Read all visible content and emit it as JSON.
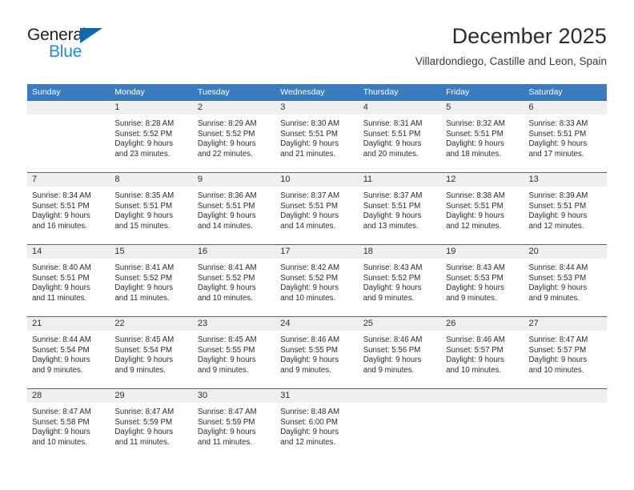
{
  "brand": {
    "name_part1": "General",
    "name_part2": "Blue",
    "logo_icon": "triangle-icon",
    "color_dark": "#231f20",
    "color_blue": "#1a8fdd",
    "color_triangle": "#0b68b2"
  },
  "header": {
    "title": "December 2025",
    "subtitle": "Villardondiego, Castille and Leon, Spain"
  },
  "theme": {
    "header_bg": "#3a7cbe",
    "header_text": "#ffffff",
    "week_divider": "#2f6fb0",
    "day_band_bg": "#efeff0",
    "body_text": "#2b2b2b"
  },
  "weekdays": [
    "Sunday",
    "Monday",
    "Tuesday",
    "Wednesday",
    "Thursday",
    "Friday",
    "Saturday"
  ],
  "weeks": [
    [
      {
        "day": "",
        "info": ""
      },
      {
        "day": "1",
        "info": "Sunrise: 8:28 AM\nSunset: 5:52 PM\nDaylight: 9 hours\nand 23 minutes."
      },
      {
        "day": "2",
        "info": "Sunrise: 8:29 AM\nSunset: 5:52 PM\nDaylight: 9 hours\nand 22 minutes."
      },
      {
        "day": "3",
        "info": "Sunrise: 8:30 AM\nSunset: 5:51 PM\nDaylight: 9 hours\nand 21 minutes."
      },
      {
        "day": "4",
        "info": "Sunrise: 8:31 AM\nSunset: 5:51 PM\nDaylight: 9 hours\nand 20 minutes."
      },
      {
        "day": "5",
        "info": "Sunrise: 8:32 AM\nSunset: 5:51 PM\nDaylight: 9 hours\nand 18 minutes."
      },
      {
        "day": "6",
        "info": "Sunrise: 8:33 AM\nSunset: 5:51 PM\nDaylight: 9 hours\nand 17 minutes."
      }
    ],
    [
      {
        "day": "7",
        "info": "Sunrise: 8:34 AM\nSunset: 5:51 PM\nDaylight: 9 hours\nand 16 minutes."
      },
      {
        "day": "8",
        "info": "Sunrise: 8:35 AM\nSunset: 5:51 PM\nDaylight: 9 hours\nand 15 minutes."
      },
      {
        "day": "9",
        "info": "Sunrise: 8:36 AM\nSunset: 5:51 PM\nDaylight: 9 hours\nand 14 minutes."
      },
      {
        "day": "10",
        "info": "Sunrise: 8:37 AM\nSunset: 5:51 PM\nDaylight: 9 hours\nand 14 minutes."
      },
      {
        "day": "11",
        "info": "Sunrise: 8:37 AM\nSunset: 5:51 PM\nDaylight: 9 hours\nand 13 minutes."
      },
      {
        "day": "12",
        "info": "Sunrise: 8:38 AM\nSunset: 5:51 PM\nDaylight: 9 hours\nand 12 minutes."
      },
      {
        "day": "13",
        "info": "Sunrise: 8:39 AM\nSunset: 5:51 PM\nDaylight: 9 hours\nand 12 minutes."
      }
    ],
    [
      {
        "day": "14",
        "info": "Sunrise: 8:40 AM\nSunset: 5:51 PM\nDaylight: 9 hours\nand 11 minutes."
      },
      {
        "day": "15",
        "info": "Sunrise: 8:41 AM\nSunset: 5:52 PM\nDaylight: 9 hours\nand 11 minutes."
      },
      {
        "day": "16",
        "info": "Sunrise: 8:41 AM\nSunset: 5:52 PM\nDaylight: 9 hours\nand 10 minutes."
      },
      {
        "day": "17",
        "info": "Sunrise: 8:42 AM\nSunset: 5:52 PM\nDaylight: 9 hours\nand 10 minutes."
      },
      {
        "day": "18",
        "info": "Sunrise: 8:43 AM\nSunset: 5:52 PM\nDaylight: 9 hours\nand 9 minutes."
      },
      {
        "day": "19",
        "info": "Sunrise: 8:43 AM\nSunset: 5:53 PM\nDaylight: 9 hours\nand 9 minutes."
      },
      {
        "day": "20",
        "info": "Sunrise: 8:44 AM\nSunset: 5:53 PM\nDaylight: 9 hours\nand 9 minutes."
      }
    ],
    [
      {
        "day": "21",
        "info": "Sunrise: 8:44 AM\nSunset: 5:54 PM\nDaylight: 9 hours\nand 9 minutes."
      },
      {
        "day": "22",
        "info": "Sunrise: 8:45 AM\nSunset: 5:54 PM\nDaylight: 9 hours\nand 9 minutes."
      },
      {
        "day": "23",
        "info": "Sunrise: 8:45 AM\nSunset: 5:55 PM\nDaylight: 9 hours\nand 9 minutes."
      },
      {
        "day": "24",
        "info": "Sunrise: 8:46 AM\nSunset: 5:55 PM\nDaylight: 9 hours\nand 9 minutes."
      },
      {
        "day": "25",
        "info": "Sunrise: 8:46 AM\nSunset: 5:56 PM\nDaylight: 9 hours\nand 9 minutes."
      },
      {
        "day": "26",
        "info": "Sunrise: 8:46 AM\nSunset: 5:57 PM\nDaylight: 9 hours\nand 10 minutes."
      },
      {
        "day": "27",
        "info": "Sunrise: 8:47 AM\nSunset: 5:57 PM\nDaylight: 9 hours\nand 10 minutes."
      }
    ],
    [
      {
        "day": "28",
        "info": "Sunrise: 8:47 AM\nSunset: 5:58 PM\nDaylight: 9 hours\nand 10 minutes."
      },
      {
        "day": "29",
        "info": "Sunrise: 8:47 AM\nSunset: 5:59 PM\nDaylight: 9 hours\nand 11 minutes."
      },
      {
        "day": "30",
        "info": "Sunrise: 8:47 AM\nSunset: 5:59 PM\nDaylight: 9 hours\nand 11 minutes."
      },
      {
        "day": "31",
        "info": "Sunrise: 8:48 AM\nSunset: 6:00 PM\nDaylight: 9 hours\nand 12 minutes."
      },
      {
        "day": "",
        "info": ""
      },
      {
        "day": "",
        "info": ""
      },
      {
        "day": "",
        "info": ""
      }
    ]
  ]
}
